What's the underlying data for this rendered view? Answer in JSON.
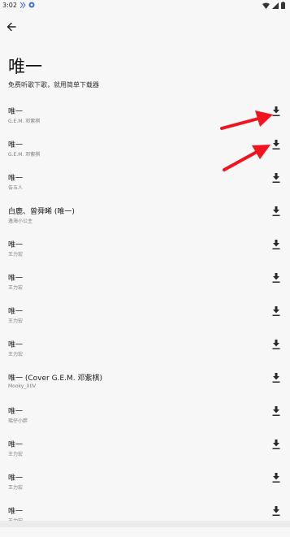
{
  "status_bar": {
    "time": "3:02"
  },
  "header": {
    "title": "唯一",
    "subtitle": "免费听歌下歌，就用简单下载器"
  },
  "songs": [
    {
      "title": "唯一",
      "artist": "G.E.M. 邓紫棋"
    },
    {
      "title": "唯一",
      "artist": "G.E.M. 邓紫棋"
    },
    {
      "title": "唯一",
      "artist": "告五人"
    },
    {
      "title": "白鹿、曾舜晞 (唯一)",
      "artist": "逸海小公主"
    },
    {
      "title": "唯一",
      "artist": "王力宏"
    },
    {
      "title": "唯一",
      "artist": "王力宏"
    },
    {
      "title": "唯一",
      "artist": "王力宏"
    },
    {
      "title": "唯一",
      "artist": "王力宏"
    },
    {
      "title": "唯一 (Cover G.E.M. 邓紫棋)",
      "artist": "Mooky_XIIV"
    },
    {
      "title": "唯一",
      "artist": "瑶仔小胖"
    },
    {
      "title": "唯一",
      "artist": "王力宏"
    },
    {
      "title": "唯一",
      "artist": "王力宏"
    },
    {
      "title": "唯一",
      "artist": "王力宏"
    }
  ],
  "icons": {
    "back": "arrow-left-icon",
    "download": "download-icon",
    "annotation": "red-arrow-icon"
  },
  "colors": {
    "annotation_arrow": "#f0141e"
  }
}
